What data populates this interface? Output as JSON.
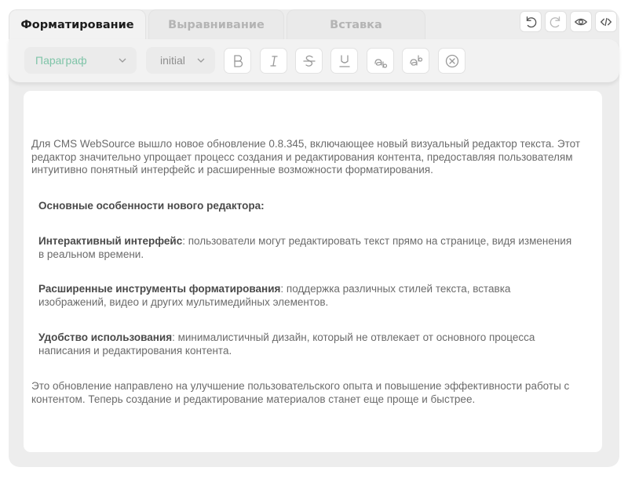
{
  "tabs": [
    {
      "label": "Форматирование",
      "active": true
    },
    {
      "label": "Выравнивание",
      "active": false
    },
    {
      "label": "Вставка",
      "active": false
    }
  ],
  "actions": {
    "icons": [
      "undo-icon",
      "redo-icon",
      "preview-eye-icon",
      "code-icon"
    ]
  },
  "toolbar": {
    "block_select": "Параграф",
    "size_select": "initial",
    "format_icons": [
      "bold-icon",
      "italic-icon",
      "strikethrough-icon",
      "underline-icon",
      "subscript-icon",
      "superscript-icon",
      "clear-format-icon"
    ]
  },
  "colors": {
    "accent": "#7fc4a8",
    "frame_bg": "#ededed",
    "editor_bg": "#ffffff"
  },
  "content": {
    "intro": "Для CMS WebSource вышло новое обновление 0.8.345, включающее новый визуальный редактор текста. Этот редактор значительно упрощает процесс создания и редактирования контента, предоставляя пользователям интуитивно понятный интерфейс и расширенные возможности форматирования.",
    "features_heading": "Основные особенности нового редактора:",
    "features": [
      {
        "title": "Интерактивный интерфейс",
        "text": ": пользователи могут редактировать текст прямо на странице, видя изменения в реальном времени."
      },
      {
        "title": "Расширенные инструменты форматирования",
        "text": ": поддержка различных стилей текста, вставка изображений, видео и других мультимедийных элементов."
      },
      {
        "title": "Удобство использования",
        "text": ": минималистичный дизайн, который не отвлекает от основного процесса написания и редактирования контента."
      }
    ],
    "outro": "Это обновление направлено на улучшение пользовательского опыта и повышение эффективности работы с контентом. Теперь создание и редактирование материалов станет еще проще и быстрее."
  }
}
